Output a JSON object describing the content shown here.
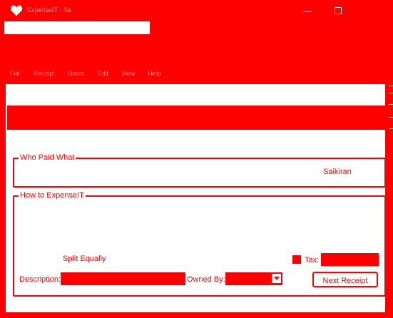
{
  "window": {
    "title": "ExpenseIT - Se",
    "minimize_glyph": "—"
  },
  "toolbar": {
    "text": ""
  },
  "menu": {
    "items": [
      "File",
      "Receipt",
      "Users",
      "Edit",
      "View",
      "Help"
    ]
  },
  "header": {
    "left": "",
    "mid": "",
    "right": ""
  },
  "who_paid": {
    "legend": "Who Paid What",
    "payer": "Saikiran"
  },
  "how_to": {
    "legend": "How to ExpenseIT",
    "split_label": "Split Equally",
    "tax_label": "Tax:",
    "tax_value": "",
    "description_label": "Description:",
    "description_value": "",
    "owned_by_label": "Owned By:",
    "owned_by_value": "",
    "next_receipt_label": "Next Receipt"
  },
  "icons": [
    "heart-icon",
    "minimize-icon",
    "maximize-icon",
    "chevron-down-icon"
  ],
  "colors": {
    "accent": "#ff0000",
    "background": "#ffffff"
  }
}
